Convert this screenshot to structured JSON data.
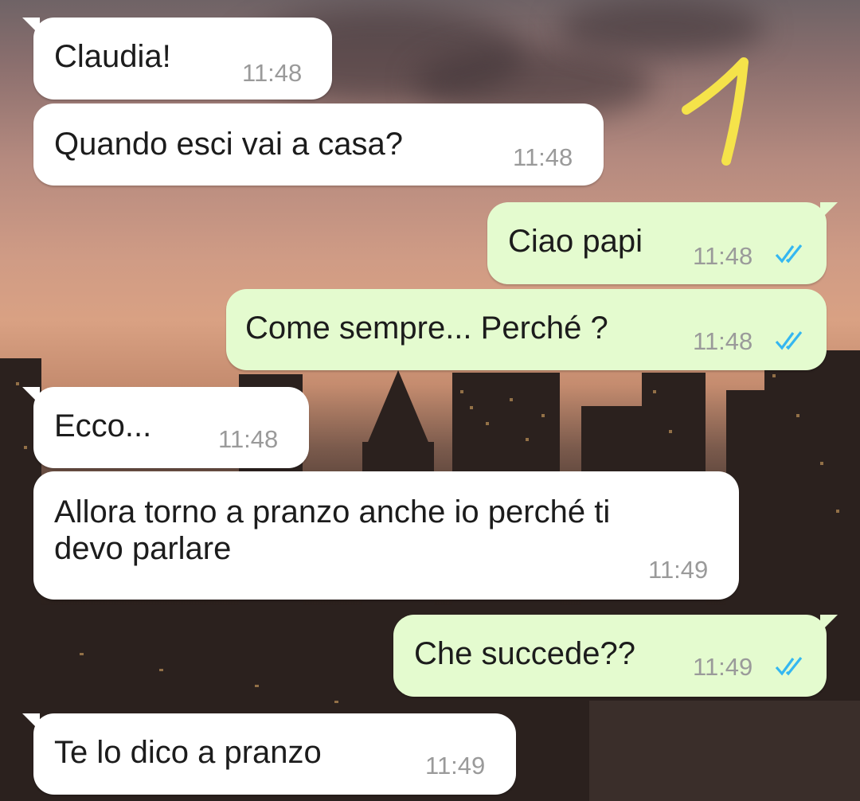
{
  "chat": {
    "messages": [
      {
        "direction": "incoming",
        "text": "Claudia!",
        "time": "11:48"
      },
      {
        "direction": "incoming",
        "text": "Quando esci vai a casa?",
        "time": "11:48"
      },
      {
        "direction": "outgoing",
        "text": "Ciao papi",
        "time": "11:48",
        "status": "read"
      },
      {
        "direction": "outgoing",
        "text": "Come sempre... Perché ?",
        "time": "11:48",
        "status": "read"
      },
      {
        "direction": "incoming",
        "text": "Ecco...",
        "time": "11:48"
      },
      {
        "direction": "incoming",
        "text": "Allora torno a pranzo anche io perché ti\ndevo parlare",
        "time": "11:49"
      },
      {
        "direction": "outgoing",
        "text": "Che succede??",
        "time": "11:49",
        "status": "read"
      },
      {
        "direction": "incoming",
        "text": "Te lo dico a pranzo",
        "time": "11:49"
      }
    ],
    "annotation": "1",
    "colors": {
      "incoming_bubble": "#ffffff",
      "outgoing_bubble": "#e4fbcf",
      "read_checks": "#34b7f1",
      "annotation": "#f5e34a"
    },
    "icons": {
      "read_receipt": "double-check-icon"
    }
  }
}
